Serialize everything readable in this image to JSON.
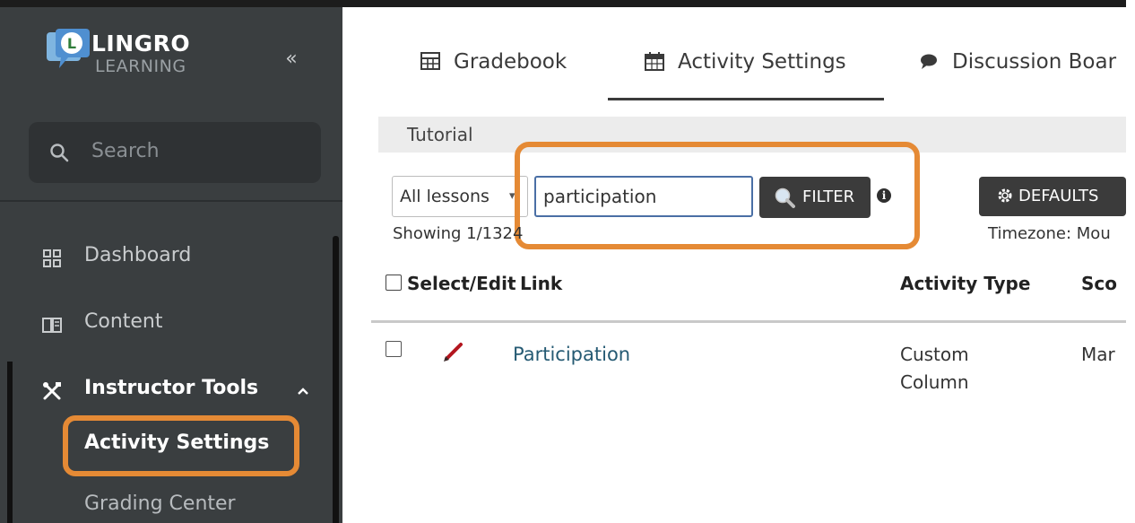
{
  "brand": {
    "line1": "LINGRO",
    "line2": "LEARNING"
  },
  "sidebar": {
    "collapse_label": "«",
    "search_placeholder": "Search",
    "items": [
      {
        "label": "Dashboard",
        "icon": "dashboard-icon"
      },
      {
        "label": "Content",
        "icon": "book-icon"
      },
      {
        "label": "Instructor Tools",
        "icon": "tools-icon",
        "expanded": true
      }
    ],
    "subitems": [
      {
        "label": "Activity Settings",
        "active": true
      },
      {
        "label": "Grading Center"
      }
    ]
  },
  "tabs": [
    {
      "label": "Gradebook",
      "icon": "table-icon"
    },
    {
      "label": "Activity Settings",
      "icon": "calendar-icon",
      "active": true
    },
    {
      "label": "Discussion Boar",
      "icon": "chat-icon"
    }
  ],
  "breadcrumb": "Tutorial",
  "filters": {
    "lessons_value": "All lessons",
    "search_value": "participation",
    "filter_label": "FILTER",
    "info_glyph": "i",
    "defaults_label": "DEFAULTS",
    "showing": "Showing 1/1324",
    "timezone": "Timezone: Mou"
  },
  "table": {
    "headers": [
      "Select/Edit",
      "Link",
      "Activity Type",
      "Sco"
    ],
    "rows": [
      {
        "link": "Participation",
        "type_line1": "Custom",
        "type_line2": "Column",
        "score": "Mar"
      }
    ]
  },
  "colors": {
    "highlight": "#e58a35",
    "sidebar": "#3a3e40",
    "link": "#255a73",
    "button": "#3b3b3b"
  }
}
